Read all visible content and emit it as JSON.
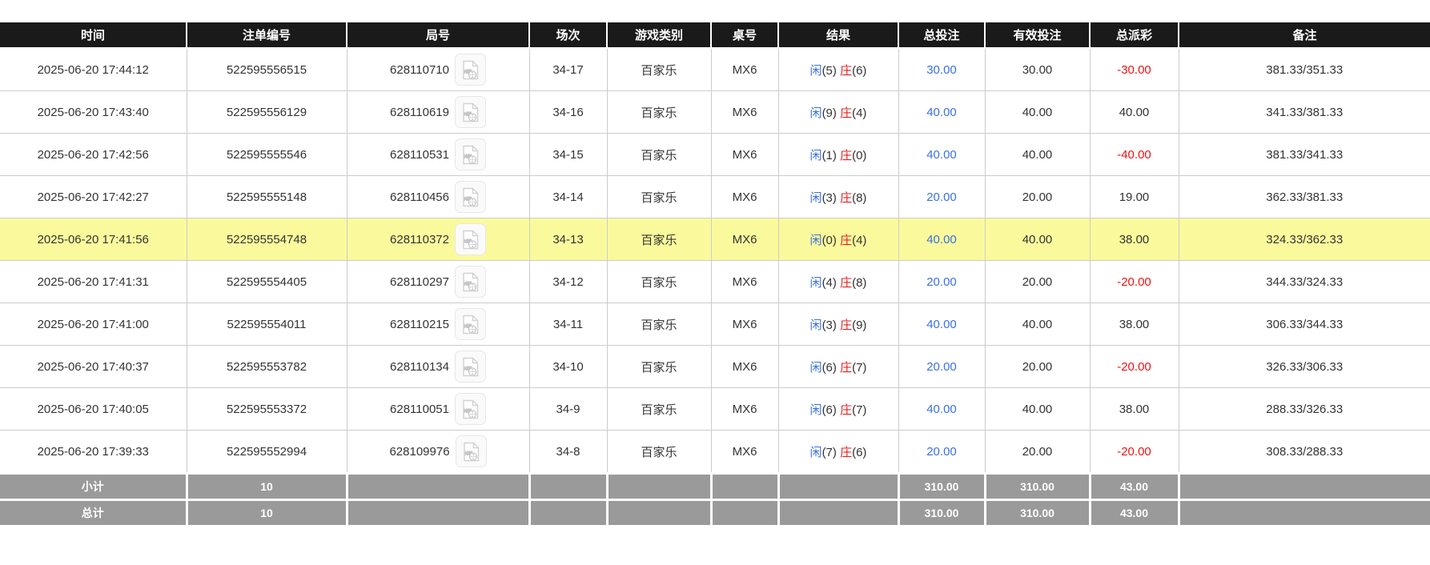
{
  "colors": {
    "header_bg": "#1a1a1a",
    "highlight_row": "#fafa9d",
    "summary_bg": "#9a9a9a",
    "bet_blue": "#3a70e0",
    "loss_red": "#ee1111",
    "banker_red": "#e02222",
    "grid_line": "#cccccc"
  },
  "icons": {
    "video_icon": "video-replay-file-icon"
  },
  "table": {
    "columns": [
      {
        "key": "time",
        "label": "时间"
      },
      {
        "key": "bet_id",
        "label": "注单编号"
      },
      {
        "key": "round_id",
        "label": "局号"
      },
      {
        "key": "session",
        "label": "场次"
      },
      {
        "key": "game_type",
        "label": "游戏类别"
      },
      {
        "key": "table_no",
        "label": "桌号"
      },
      {
        "key": "result",
        "label": "结果"
      },
      {
        "key": "total_bet",
        "label": "总投注"
      },
      {
        "key": "valid_bet",
        "label": "有效投注"
      },
      {
        "key": "payout",
        "label": "总派彩"
      },
      {
        "key": "remark",
        "label": "备注"
      }
    ],
    "rows": [
      {
        "time": "2025-06-20 17:44:12",
        "bet_id": "522595556515",
        "round_id": "628110710",
        "session": "34-17",
        "game_type": "百家乐",
        "table_no": "MX6",
        "result_player": "闲",
        "result_player_pts": "(5)",
        "result_banker": "庄",
        "result_banker_pts": "(6)",
        "total_bet": "30.00",
        "valid_bet": "30.00",
        "payout": "-30.00",
        "remark": "381.33/351.33",
        "highlight": false
      },
      {
        "time": "2025-06-20 17:43:40",
        "bet_id": "522595556129",
        "round_id": "628110619",
        "session": "34-16",
        "game_type": "百家乐",
        "table_no": "MX6",
        "result_player": "闲",
        "result_player_pts": "(9)",
        "result_banker": "庄",
        "result_banker_pts": "(4)",
        "total_bet": "40.00",
        "valid_bet": "40.00",
        "payout": "40.00",
        "remark": "341.33/381.33",
        "highlight": false
      },
      {
        "time": "2025-06-20 17:42:56",
        "bet_id": "522595555546",
        "round_id": "628110531",
        "session": "34-15",
        "game_type": "百家乐",
        "table_no": "MX6",
        "result_player": "闲",
        "result_player_pts": "(1)",
        "result_banker": "庄",
        "result_banker_pts": "(0)",
        "total_bet": "40.00",
        "valid_bet": "40.00",
        "payout": "-40.00",
        "remark": "381.33/341.33",
        "highlight": false
      },
      {
        "time": "2025-06-20 17:42:27",
        "bet_id": "522595555148",
        "round_id": "628110456",
        "session": "34-14",
        "game_type": "百家乐",
        "table_no": "MX6",
        "result_player": "闲",
        "result_player_pts": "(3)",
        "result_banker": "庄",
        "result_banker_pts": "(8)",
        "total_bet": "20.00",
        "valid_bet": "20.00",
        "payout": "19.00",
        "remark": "362.33/381.33",
        "highlight": false
      },
      {
        "time": "2025-06-20 17:41:56",
        "bet_id": "522595554748",
        "round_id": "628110372",
        "session": "34-13",
        "game_type": "百家乐",
        "table_no": "MX6",
        "result_player": "闲",
        "result_player_pts": "(0)",
        "result_banker": "庄",
        "result_banker_pts": "(4)",
        "total_bet": "40.00",
        "valid_bet": "40.00",
        "payout": "38.00",
        "remark": "324.33/362.33",
        "highlight": true
      },
      {
        "time": "2025-06-20 17:41:31",
        "bet_id": "522595554405",
        "round_id": "628110297",
        "session": "34-12",
        "game_type": "百家乐",
        "table_no": "MX6",
        "result_player": "闲",
        "result_player_pts": "(4)",
        "result_banker": "庄",
        "result_banker_pts": "(8)",
        "total_bet": "20.00",
        "valid_bet": "20.00",
        "payout": "-20.00",
        "remark": "344.33/324.33",
        "highlight": false
      },
      {
        "time": "2025-06-20 17:41:00",
        "bet_id": "522595554011",
        "round_id": "628110215",
        "session": "34-11",
        "game_type": "百家乐",
        "table_no": "MX6",
        "result_player": "闲",
        "result_player_pts": "(3)",
        "result_banker": "庄",
        "result_banker_pts": "(9)",
        "total_bet": "40.00",
        "valid_bet": "40.00",
        "payout": "38.00",
        "remark": "306.33/344.33",
        "highlight": false
      },
      {
        "time": "2025-06-20 17:40:37",
        "bet_id": "522595553782",
        "round_id": "628110134",
        "session": "34-10",
        "game_type": "百家乐",
        "table_no": "MX6",
        "result_player": "闲",
        "result_player_pts": "(6)",
        "result_banker": "庄",
        "result_banker_pts": "(7)",
        "total_bet": "20.00",
        "valid_bet": "20.00",
        "payout": "-20.00",
        "remark": "326.33/306.33",
        "highlight": false
      },
      {
        "time": "2025-06-20 17:40:05",
        "bet_id": "522595553372",
        "round_id": "628110051",
        "session": "34-9",
        "game_type": "百家乐",
        "table_no": "MX6",
        "result_player": "闲",
        "result_player_pts": "(6)",
        "result_banker": "庄",
        "result_banker_pts": "(7)",
        "total_bet": "40.00",
        "valid_bet": "40.00",
        "payout": "38.00",
        "remark": "288.33/326.33",
        "highlight": false
      },
      {
        "time": "2025-06-20 17:39:33",
        "bet_id": "522595552994",
        "round_id": "628109976",
        "session": "34-8",
        "game_type": "百家乐",
        "table_no": "MX6",
        "result_player": "闲",
        "result_player_pts": "(7)",
        "result_banker": "庄",
        "result_banker_pts": "(6)",
        "total_bet": "20.00",
        "valid_bet": "20.00",
        "payout": "-20.00",
        "remark": "308.33/288.33",
        "highlight": false
      }
    ],
    "summary_rows": [
      {
        "label": "小计",
        "count": "10",
        "total_bet": "310.00",
        "valid_bet": "310.00",
        "payout": "43.00"
      },
      {
        "label": "总计",
        "count": "10",
        "total_bet": "310.00",
        "valid_bet": "310.00",
        "payout": "43.00"
      }
    ]
  }
}
